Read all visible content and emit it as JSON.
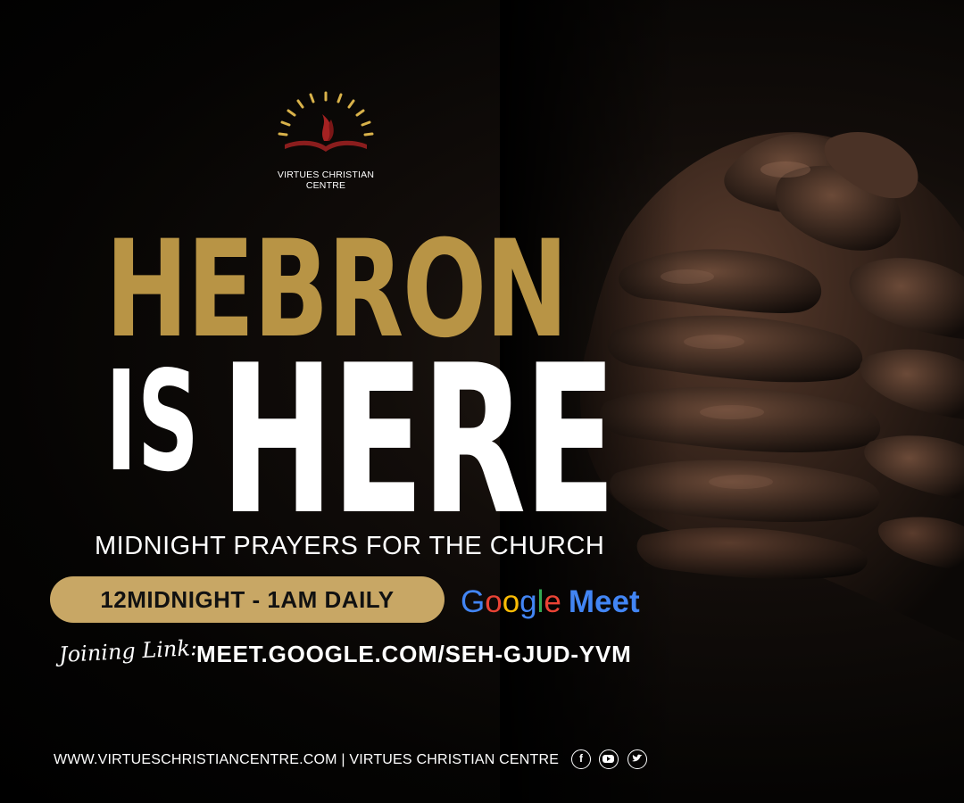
{
  "logo": {
    "org_name": "VIRTUES CHRISTIAN CENTRE",
    "icon": "flame-book-sunrise-icon",
    "color": "#8b1d1d"
  },
  "headline": {
    "line1": "HEBRON",
    "line2a": "IS",
    "line2b": "HERE"
  },
  "subtitle": "MIDNIGHT PRAYERS FOR THE CHURCH",
  "schedule": "12MIDNIGHT - 1AM DAILY",
  "platform": {
    "google": [
      "G",
      "o",
      "o",
      "g",
      "l",
      "e"
    ],
    "meet": "Meet"
  },
  "joining": {
    "label": "Joining Link:",
    "url": "MEET.GOOGLE.COM/SEH-GJUD-YVM"
  },
  "footer": {
    "text": "WWW.VIRTUESCHRISTIANCENTRE.COM | VIRTUES CHRISTIAN CENTRE",
    "social_icons": [
      "facebook-icon",
      "youtube-icon",
      "twitter-icon"
    ]
  },
  "colors": {
    "gold": "#b89445",
    "pill": "#c8a765",
    "background": "#000000"
  }
}
